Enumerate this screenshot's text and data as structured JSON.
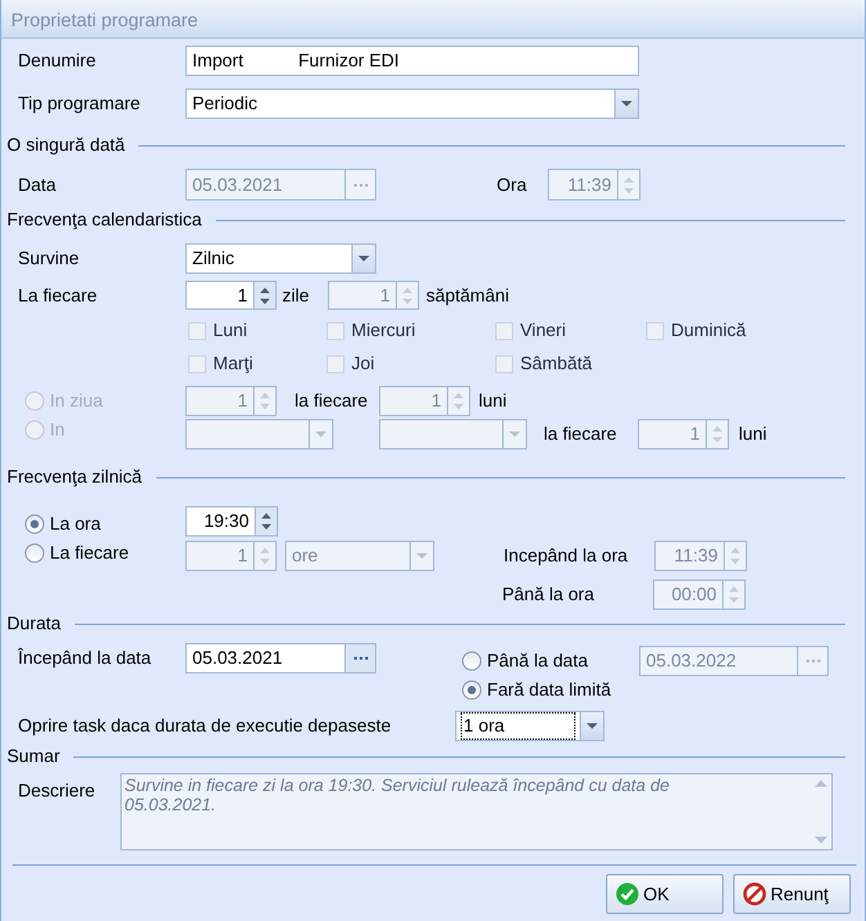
{
  "window": {
    "title": "Proprietati programare"
  },
  "general": {
    "name": {
      "label": "Denumire",
      "value": "Import           Furnizor EDI",
      "disabled": false
    },
    "schedule_type": {
      "label": "Tip programare",
      "value": "Periodic",
      "disabled": false
    }
  },
  "once": {
    "title": "O singură dată",
    "date": {
      "label": "Data",
      "value": "05.03.2021",
      "disabled": true
    },
    "time": {
      "label": "Ora",
      "value": "11:39",
      "disabled": true
    }
  },
  "calendar": {
    "title": "Frecvenţa calendaristica",
    "occurs": {
      "label": "Survine",
      "value": "Zilnic",
      "disabled": false
    },
    "every_label": "La fiecare",
    "days": {
      "value": "1",
      "disabled": false,
      "unit": "zile"
    },
    "weeks": {
      "value": "1",
      "disabled": true,
      "unit": "săptămâni"
    },
    "weekdays": [
      {
        "label": "Luni",
        "checked": false,
        "disabled": true
      },
      {
        "label": "Miercuri",
        "checked": false,
        "disabled": true
      },
      {
        "label": "Vineri",
        "checked": false,
        "disabled": true
      },
      {
        "label": "Duminică",
        "checked": false,
        "disabled": true
      },
      {
        "label": "Marţi",
        "checked": false,
        "disabled": true
      },
      {
        "label": "Joi",
        "checked": false,
        "disabled": true
      },
      {
        "label": "Sâmbătă",
        "checked": false,
        "disabled": true
      }
    ],
    "monthly_day": {
      "label": "In ziua",
      "selected": false,
      "disabled": true,
      "day": {
        "value": "1",
        "disabled": true
      },
      "every_label": "la fiecare",
      "months": {
        "value": "1",
        "disabled": true
      },
      "unit": "luni"
    },
    "monthly_weekday": {
      "label": "In",
      "selected": false,
      "disabled": true,
      "ordinal": {
        "disabled": true
      },
      "weekday": {
        "disabled": true
      },
      "every_label": "la fiecare",
      "months": {
        "value": "1",
        "disabled": true
      },
      "unit": "luni"
    }
  },
  "daily": {
    "title": "Frecvenţa zilnică",
    "at": {
      "label": "La ora",
      "selected": true,
      "disabled": false,
      "time": {
        "value": "19:30",
        "disabled": false
      }
    },
    "every": {
      "label": "La fiecare",
      "selected": false,
      "disabled": false,
      "count": {
        "value": "1",
        "disabled": true
      },
      "unit": {
        "value": "ore",
        "disabled": true
      }
    },
    "start": {
      "label": "Incepând la ora",
      "value": "11:39",
      "disabled": true
    },
    "end": {
      "label": "Până la ora",
      "value": "00:00",
      "disabled": true
    }
  },
  "duration": {
    "title": "Durata",
    "start": {
      "label": "Începând la data",
      "value": "05.03.2021",
      "disabled": false
    },
    "end_options": [
      {
        "label": "Până la data",
        "selected": false
      },
      {
        "label": "Fară data limită",
        "selected": true
      }
    ],
    "end_date": {
      "value": "05.03.2022",
      "disabled": true
    },
    "timeout": {
      "label": "Oprire task daca durata de executie depaseste",
      "value": "1 ora",
      "disabled": false,
      "focused": true
    }
  },
  "summary": {
    "title": "Sumar",
    "label": "Descriere",
    "text": "Survine in fiecare zi la ora 19:30. Serviciul rulează începând cu data de 05.03.2021."
  },
  "buttons": [
    {
      "label": "OK",
      "kind": "ok"
    },
    {
      "label": "Renunţ",
      "kind": "cancel"
    }
  ]
}
